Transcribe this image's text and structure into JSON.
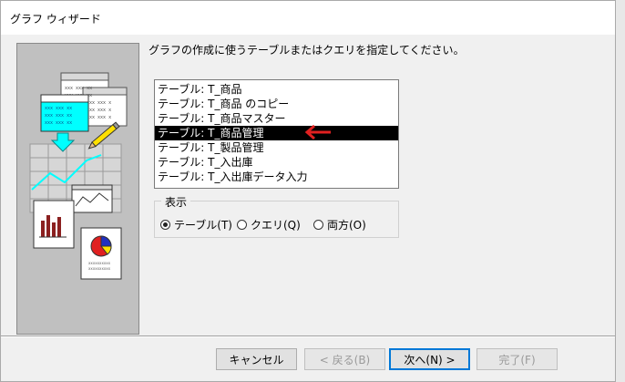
{
  "dialog": {
    "title": "グラフ ウィザード",
    "prompt": "グラフの作成に使うテーブルまたはクエリを指定してください。"
  },
  "list": {
    "items": [
      "テーブル: T_商品",
      "テーブル: T_商品 のコピー",
      "テーブル: T_商品マスター",
      "テーブル: T_商品管理",
      "テーブル: T_製品管理",
      "テーブル: T_入出庫",
      "テーブル: T_入出庫データ入力"
    ],
    "selected_index": 3
  },
  "view_group": {
    "legend": "表示",
    "options": [
      {
        "label": "テーブル(T)",
        "checked": true
      },
      {
        "label": "クエリ(Q)",
        "checked": false
      },
      {
        "label": "両方(O)",
        "checked": false
      }
    ]
  },
  "buttons": {
    "cancel": "キャンセル",
    "back": "< 戻る(B)",
    "next": "次へ(N) >",
    "finish": "完了(F)"
  },
  "colors": {
    "arrow": "#e02020",
    "selection_bg": "#000000",
    "default_button_border": "#0078d7",
    "table_cyan": "#00ffff"
  }
}
